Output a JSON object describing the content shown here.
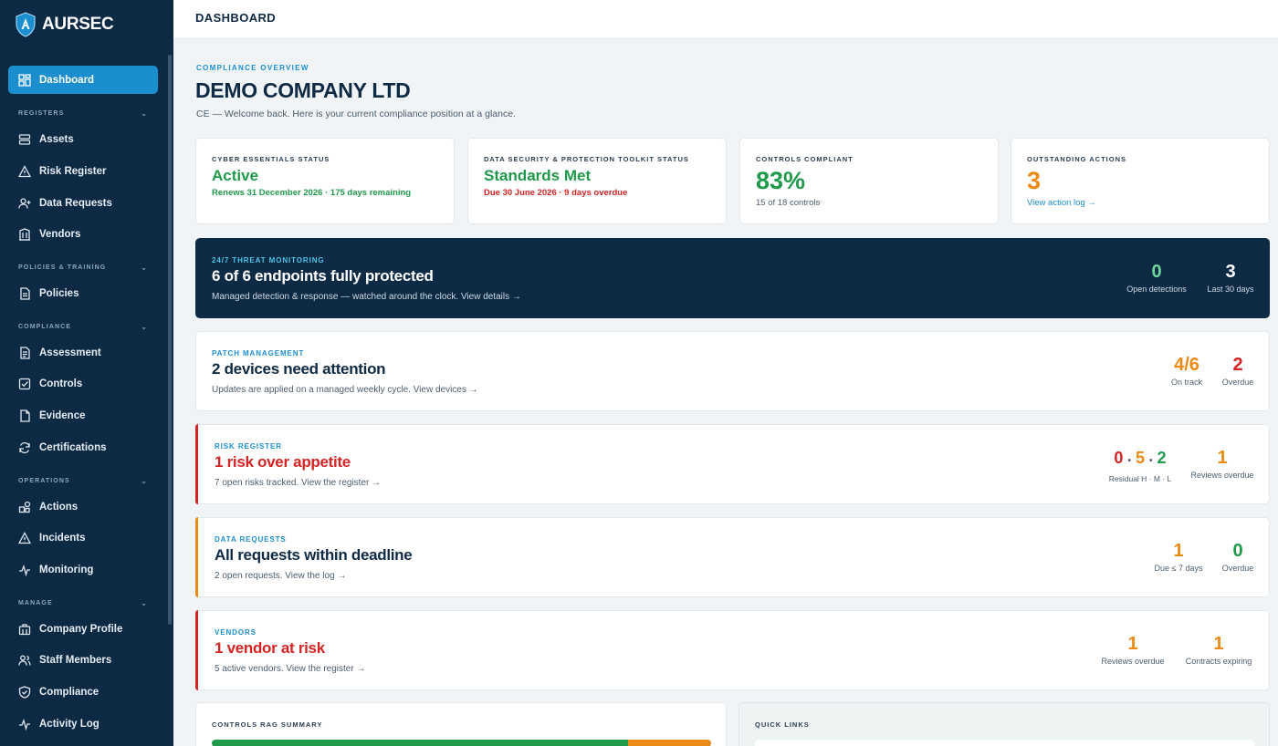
{
  "brand": {
    "name": "AURSEC"
  },
  "sidebar": {
    "dashboard": "Dashboard",
    "sections": {
      "registers": "REGISTERS",
      "policies": "POLICIES & TRAINING",
      "compliance": "COMPLIANCE",
      "operations": "OPERATIONS",
      "manage": "MANAGE"
    },
    "items": {
      "assets": "Assets",
      "risk_register": "Risk Register",
      "data_requests": "Data Requests",
      "vendors": "Vendors",
      "policies": "Policies",
      "assessment": "Assessment",
      "controls": "Controls",
      "evidence": "Evidence",
      "certifications": "Certifications",
      "actions": "Actions",
      "incidents": "Incidents",
      "monitoring": "Monitoring",
      "company_profile": "Company Profile",
      "staff_members": "Staff Members",
      "compliance": "Compliance",
      "activity_log": "Activity Log"
    }
  },
  "topbar": {
    "title": "DASHBOARD"
  },
  "overview": {
    "eyebrow": "COMPLIANCE OVERVIEW",
    "company": "DEMO COMPANY LTD",
    "welcome": "CE — Welcome back. Here is your current compliance position at a glance."
  },
  "cards": {
    "ce": {
      "label": "CYBER ESSENTIALS STATUS",
      "value": "Active",
      "sub": "Renews 31 December 2026 · 175 days remaining"
    },
    "dspt": {
      "label": "DATA SECURITY & PROTECTION TOOLKIT STATUS",
      "value": "Standards Met",
      "sub": "Due 30 June 2026 · 9 days overdue"
    },
    "controls": {
      "label": "CONTROLS COMPLIANT",
      "value": "83%",
      "sub": "15 of 18 controls"
    },
    "actions": {
      "label": "OUTSTANDING ACTIONS",
      "value": "3",
      "sub": "View action log →"
    }
  },
  "threat": {
    "eyebrow": "24/7 THREAT MONITORING",
    "title": "6 of 6 endpoints fully protected",
    "sub": "Managed detection & response — watched around the clock. View details →",
    "stat1": {
      "value": "0",
      "label": "Open detections"
    },
    "stat2": {
      "value": "3",
      "label": "Last 30 days"
    }
  },
  "patch": {
    "eyebrow": "PATCH MANAGEMENT",
    "title": "2 devices need attention",
    "sub": "Updates are applied on a managed weekly cycle. View devices →",
    "stat1": {
      "value": "4/6",
      "label": "On track"
    },
    "stat2": {
      "value": "2",
      "label": "Overdue"
    }
  },
  "risk": {
    "eyebrow": "RISK REGISTER",
    "title": "1 risk over appetite",
    "sub": "7 open risks tracked. View the register →",
    "residual": {
      "h": "0",
      "m": "5",
      "l": "2",
      "dot": "•",
      "label": "Residual H · M · L"
    },
    "stat2": {
      "value": "1",
      "label": "Reviews overdue"
    }
  },
  "requests": {
    "eyebrow": "DATA REQUESTS",
    "title": "All requests within deadline",
    "sub": "2 open requests. View the log →",
    "stat1": {
      "value": "1",
      "label": "Due ≤ 7 days"
    },
    "stat2": {
      "value": "0",
      "label": "Overdue"
    }
  },
  "vendors": {
    "eyebrow": "VENDORS",
    "title": "1 vendor at risk",
    "sub": "5 active vendors. View the register →",
    "stat1": {
      "value": "1",
      "label": "Reviews overdue"
    },
    "stat2": {
      "value": "1",
      "label": "Contracts expiring"
    }
  },
  "rag": {
    "label": "CONTROLS RAG SUMMARY",
    "segments": [
      {
        "name": "green",
        "value": 15,
        "color": "#1f9a4b"
      },
      {
        "name": "amber",
        "value": 3,
        "color": "#ea8a14"
      }
    ]
  },
  "quick_links": {
    "label": "QUICK LINKS"
  }
}
